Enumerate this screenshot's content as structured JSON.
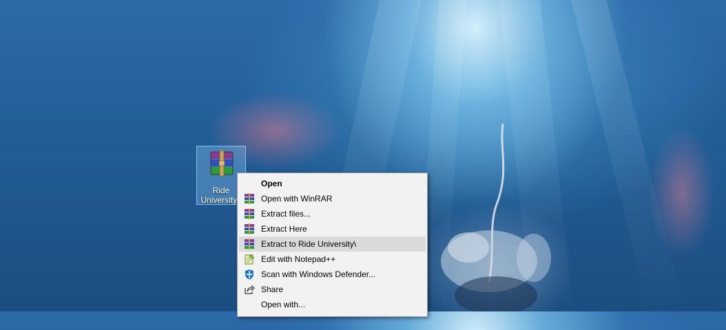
{
  "desktop": {
    "file_icon": {
      "name": "rar-archive-icon",
      "label_line1": "Ride",
      "label_line2": "University.r"
    }
  },
  "context_menu": {
    "items": [
      {
        "label": "Open",
        "icon": "none",
        "bold": true
      },
      {
        "label": "Open with WinRAR",
        "icon": "winrar-icon"
      },
      {
        "label": "Extract files...",
        "icon": "winrar-icon"
      },
      {
        "label": "Extract Here",
        "icon": "winrar-icon"
      },
      {
        "label": "Extract to Ride University\\",
        "icon": "winrar-icon",
        "highlighted": true
      },
      {
        "label": "Edit with Notepad++",
        "icon": "notepad-plus-plus-icon"
      },
      {
        "label": "Scan with Windows Defender...",
        "icon": "windows-defender-icon"
      },
      {
        "label": "Share",
        "icon": "share-icon"
      },
      {
        "label": "Open with...",
        "icon": "none"
      }
    ]
  },
  "colors": {
    "menu_background": "#f2f2f2",
    "menu_highlight": "#dadada",
    "icon_selection": "#99d1ff"
  }
}
